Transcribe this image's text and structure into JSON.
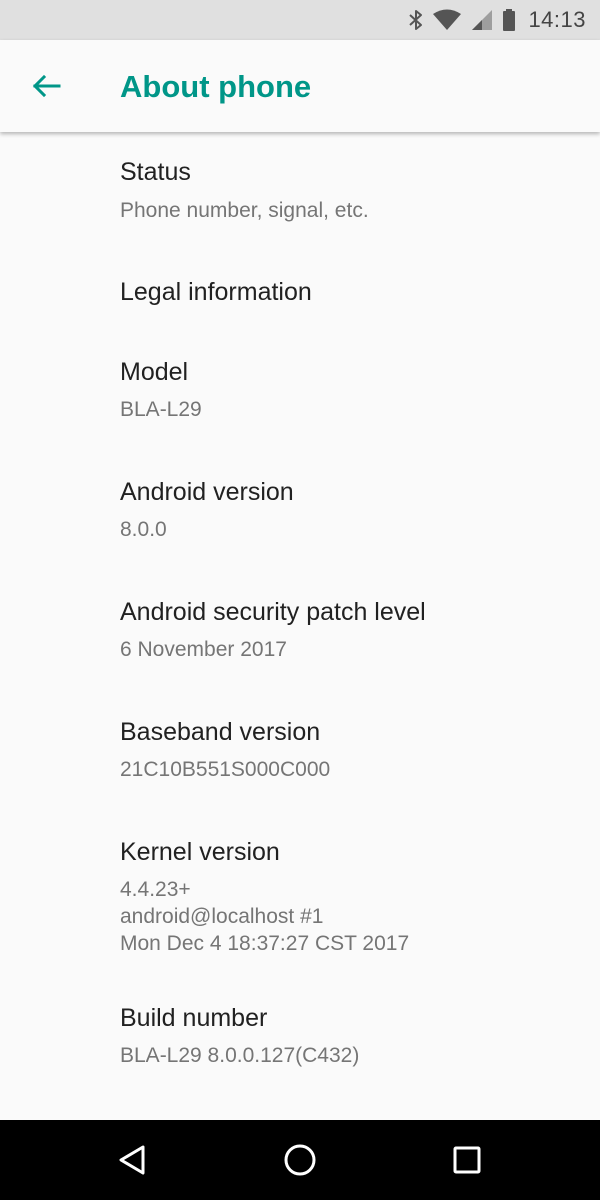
{
  "status_bar": {
    "time": "14:13",
    "icons": [
      "bluetooth-icon",
      "wifi-icon",
      "cell-signal-icon",
      "battery-icon"
    ]
  },
  "app_bar": {
    "title": "About phone",
    "back_icon": "arrow-back-icon",
    "accent_color": "#009688"
  },
  "items": [
    {
      "title": "Status",
      "summary": "Phone number, signal, etc."
    },
    {
      "title": "Legal information",
      "summary": ""
    },
    {
      "title": "Model",
      "summary": "BLA-L29"
    },
    {
      "title": "Android version",
      "summary": "8.0.0"
    },
    {
      "title": "Android security patch level",
      "summary": "6 November 2017"
    },
    {
      "title": "Baseband version",
      "summary": "21C10B551S000C000"
    },
    {
      "title": "Kernel version",
      "summary": "4.4.23+\nandroid@localhost #1\nMon Dec 4 18:37:27 CST 2017"
    },
    {
      "title": "Build number",
      "summary": "BLA-L29 8.0.0.127(C432)"
    }
  ],
  "nav_bar": {
    "icons": [
      "back-triangle-icon",
      "home-circle-icon",
      "recents-square-icon"
    ]
  }
}
